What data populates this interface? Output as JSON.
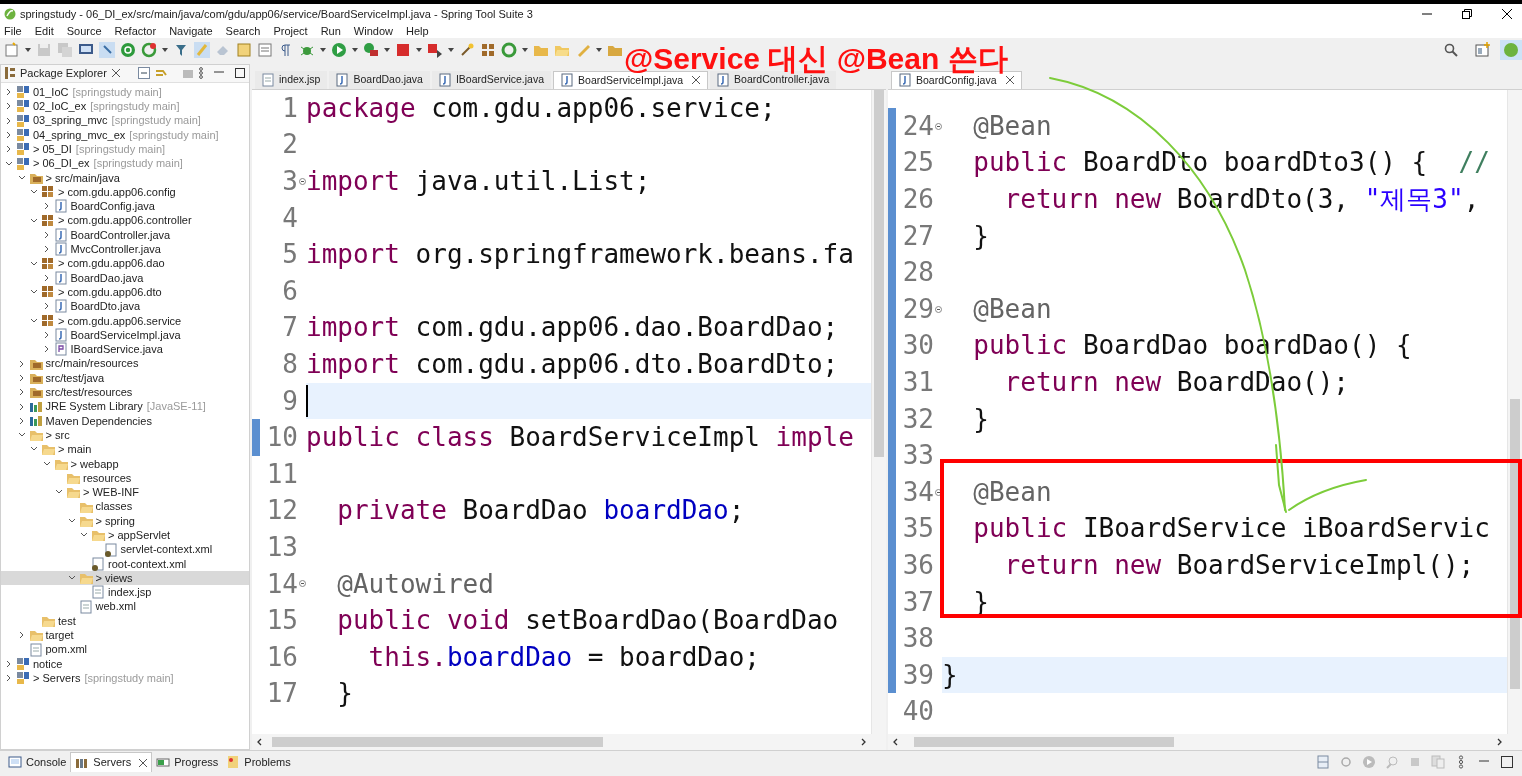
{
  "window": {
    "title": "springstudy - 06_DI_ex/src/main/java/com/gdu/app06/service/BoardServiceImpl.java - Spring Tool Suite 3"
  },
  "menu": [
    "File",
    "Edit",
    "Source",
    "Refactor",
    "Navigate",
    "Search",
    "Project",
    "Run",
    "Window",
    "Help"
  ],
  "package_explorer": {
    "title": "Package Explorer",
    "tree": [
      {
        "label": "01_IoC",
        "decoration": "[springstudy main]",
        "kind": "project",
        "expanded": false,
        "selected": false
      },
      {
        "label": "02_IoC_ex",
        "decoration": "[springstudy main]",
        "kind": "project",
        "expanded": false,
        "selected": false
      },
      {
        "label": "03_spring_mvc",
        "decoration": "[springstudy main]",
        "kind": "project",
        "expanded": false,
        "selected": false
      },
      {
        "label": "04_spring_mvc_ex",
        "decoration": "[springstudy main]",
        "kind": "project",
        "expanded": false,
        "selected": false
      },
      {
        "label": "> 05_DI",
        "decoration": "[springstudy main]",
        "kind": "project",
        "expanded": false,
        "selected": false
      },
      {
        "label": "> 06_DI_ex",
        "decoration": "[springstudy main]",
        "kind": "project",
        "expanded": true,
        "selected": false,
        "children": [
          {
            "label": "> src/main/java",
            "kind": "source-folder",
            "expanded": true,
            "selected": false,
            "children": [
              {
                "label": "> com.gdu.app06.config",
                "kind": "package",
                "expanded": true,
                "selected": false,
                "children": [
                  {
                    "label": "BoardConfig.java",
                    "kind": "java",
                    "expanded": false,
                    "selected": false
                  }
                ]
              },
              {
                "label": "> com.gdu.app06.controller",
                "kind": "package",
                "expanded": true,
                "selected": false,
                "children": [
                  {
                    "label": "BoardController.java",
                    "kind": "java",
                    "expanded": false,
                    "selected": false
                  },
                  {
                    "label": "MvcController.java",
                    "kind": "java",
                    "expanded": false,
                    "selected": false
                  }
                ]
              },
              {
                "label": "> com.gdu.app06.dao",
                "kind": "package",
                "expanded": true,
                "selected": false,
                "children": [
                  {
                    "label": "BoardDao.java",
                    "kind": "java",
                    "expanded": false,
                    "selected": false
                  }
                ]
              },
              {
                "label": "> com.gdu.app06.dto",
                "kind": "package",
                "expanded": true,
                "selected": false,
                "children": [
                  {
                    "label": "BoardDto.java",
                    "kind": "java",
                    "expanded": false,
                    "selected": false
                  }
                ]
              },
              {
                "label": "> com.gdu.app06.service",
                "kind": "package",
                "expanded": true,
                "selected": false,
                "children": [
                  {
                    "label": "BoardServiceImpl.java",
                    "kind": "java",
                    "expanded": false,
                    "selected": false
                  },
                  {
                    "label": "IBoardService.java",
                    "kind": "interface",
                    "expanded": false,
                    "selected": false
                  }
                ]
              }
            ]
          },
          {
            "label": "src/main/resources",
            "kind": "source-folder",
            "expanded": false,
            "selected": false
          },
          {
            "label": "src/test/java",
            "kind": "source-folder",
            "expanded": false,
            "selected": false
          },
          {
            "label": "src/test/resources",
            "kind": "source-folder",
            "expanded": false,
            "selected": false
          },
          {
            "label": "JRE System Library",
            "decoration": "[JavaSE-11]",
            "kind": "library",
            "expanded": false,
            "selected": false
          },
          {
            "label": "Maven Dependencies",
            "kind": "library",
            "expanded": false,
            "selected": false
          },
          {
            "label": "> src",
            "kind": "folder",
            "expanded": true,
            "selected": false,
            "children": [
              {
                "label": "> main",
                "kind": "folder",
                "expanded": true,
                "selected": false,
                "children": [
                  {
                    "label": "> webapp",
                    "kind": "folder",
                    "expanded": true,
                    "selected": false,
                    "children": [
                      {
                        "label": "resources",
                        "kind": "folder",
                        "selected": false
                      },
                      {
                        "label": "> WEB-INF",
                        "kind": "folder",
                        "expanded": true,
                        "selected": false,
                        "children": [
                          {
                            "label": "classes",
                            "kind": "folder",
                            "selected": false
                          },
                          {
                            "label": "> spring",
                            "kind": "folder",
                            "expanded": true,
                            "selected": false,
                            "children": [
                              {
                                "label": "> appServlet",
                                "kind": "folder",
                                "expanded": true,
                                "selected": false,
                                "children": [
                                  {
                                    "label": "servlet-context.xml",
                                    "kind": "xml",
                                    "selected": false
                                  }
                                ]
                              },
                              {
                                "label": "root-context.xml",
                                "kind": "xml",
                                "selected": false
                              }
                            ]
                          },
                          {
                            "label": "> views",
                            "kind": "folder",
                            "expanded": true,
                            "selected": true,
                            "children": [
                              {
                                "label": "index.jsp",
                                "kind": "file",
                                "selected": false
                              }
                            ]
                          },
                          {
                            "label": "web.xml",
                            "kind": "file",
                            "selected": false
                          }
                        ]
                      }
                    ]
                  }
                ]
              },
              {
                "label": "test",
                "kind": "folder",
                "selected": false
              }
            ]
          },
          {
            "label": "target",
            "kind": "folder",
            "expanded": false,
            "selected": false
          },
          {
            "label": "pom.xml",
            "kind": "file",
            "selected": false
          }
        ]
      },
      {
        "label": "notice",
        "kind": "project",
        "expanded": false,
        "selected": false
      },
      {
        "label": "> Servers",
        "decoration": "[springstudy main]",
        "kind": "project",
        "expanded": false,
        "selected": false
      }
    ]
  },
  "editors": [
    {
      "tabs": [
        {
          "label": "index.jsp",
          "kind": "jsp",
          "selected": false
        },
        {
          "label": "BoardDao.java",
          "kind": "java",
          "selected": false
        },
        {
          "label": "IBoardService.java",
          "kind": "java",
          "selected": false
        },
        {
          "label": "BoardServiceImpl.java",
          "kind": "java",
          "selected": true
        },
        {
          "label": "BoardController.java",
          "kind": "java",
          "selected": false
        }
      ],
      "lines": [
        {
          "number": "1",
          "tokens": [
            {
              "kind": "keyword",
              "text": "package"
            },
            {
              "kind": "plain",
              "text": " com.gdu.app06.service;"
            }
          ]
        },
        {
          "number": "2"
        },
        {
          "number": "3",
          "foldable": true,
          "tokens": [
            {
              "kind": "keyword",
              "text": "import"
            },
            {
              "kind": "plain",
              "text": " java.util.List;"
            }
          ]
        },
        {
          "number": "4"
        },
        {
          "number": "5",
          "tokens": [
            {
              "kind": "keyword",
              "text": "import"
            },
            {
              "kind": "plain",
              "text": " org.springframework.beans.fa"
            }
          ]
        },
        {
          "number": "6"
        },
        {
          "number": "7",
          "tokens": [
            {
              "kind": "keyword",
              "text": "import"
            },
            {
              "kind": "plain",
              "text": " com.gdu.app06.dao.BoardDao;"
            }
          ]
        },
        {
          "number": "8",
          "tokens": [
            {
              "kind": "keyword",
              "text": "import"
            },
            {
              "kind": "plain",
              "text": " com.gdu.app06.dto.BoardDto;"
            }
          ]
        },
        {
          "number": "9",
          "current": true
        },
        {
          "number": "10",
          "in_range": true,
          "tokens": [
            {
              "kind": "keyword",
              "text": "public class"
            },
            {
              "kind": "plain",
              "text": " BoardServiceImpl "
            },
            {
              "kind": "keyword",
              "text": "imple"
            }
          ]
        },
        {
          "number": "11"
        },
        {
          "number": "12",
          "tokens": [
            {
              "kind": "keyword",
              "text": "  private"
            },
            {
              "kind": "plain",
              "text": " BoardDao "
            },
            {
              "kind": "field",
              "text": "boardDao"
            },
            {
              "kind": "plain",
              "text": ";"
            }
          ]
        },
        {
          "number": "13"
        },
        {
          "number": "14",
          "foldable": true,
          "tokens": [
            {
              "kind": "annotation",
              "text": "  @Autowired"
            }
          ]
        },
        {
          "number": "15",
          "tokens": [
            {
              "kind": "keyword",
              "text": "  public void"
            },
            {
              "kind": "plain",
              "text": " setBoardDao(BoardDao"
            }
          ]
        },
        {
          "number": "16",
          "tokens": [
            {
              "kind": "keyword",
              "text": "    this."
            },
            {
              "kind": "field",
              "text": "boardDao"
            },
            {
              "kind": "plain",
              "text": " = boardDao;"
            }
          ]
        },
        {
          "number": "17",
          "tokens": [
            {
              "kind": "plain",
              "text": "  }"
            }
          ]
        }
      ]
    },
    {
      "tabs": [
        {
          "label": "BoardConfig.java",
          "kind": "java",
          "selected": true
        }
      ],
      "lines": [
        {
          "number": "24",
          "foldable": true,
          "in_range": true,
          "tokens": [
            {
              "kind": "annotation",
              "text": "  @Bean"
            }
          ]
        },
        {
          "number": "25",
          "in_range": true,
          "tokens": [
            {
              "kind": "keyword",
              "text": "  public"
            },
            {
              "kind": "plain",
              "text": " BoardDto boardDto3() {  "
            },
            {
              "kind": "comment",
              "text": "//"
            }
          ]
        },
        {
          "number": "26",
          "in_range": true,
          "tokens": [
            {
              "kind": "keyword",
              "text": "    return new"
            },
            {
              "kind": "plain",
              "text": " BoardDto(3, "
            },
            {
              "kind": "string",
              "text": "\"제목3\""
            },
            {
              "kind": "plain",
              "text": ","
            }
          ]
        },
        {
          "number": "27",
          "in_range": true,
          "tokens": [
            {
              "kind": "plain",
              "text": "  }"
            }
          ]
        },
        {
          "number": "28",
          "in_range": true
        },
        {
          "number": "29",
          "foldable": true,
          "in_range": true,
          "tokens": [
            {
              "kind": "annotation",
              "text": "  @Bean"
            }
          ]
        },
        {
          "number": "30",
          "in_range": true,
          "tokens": [
            {
              "kind": "keyword",
              "text": "  public"
            },
            {
              "kind": "plain",
              "text": " BoardDao boardDao() {"
            }
          ]
        },
        {
          "number": "31",
          "in_range": true,
          "tokens": [
            {
              "kind": "keyword",
              "text": "    return new"
            },
            {
              "kind": "plain",
              "text": " BoardDao();"
            }
          ]
        },
        {
          "number": "32",
          "in_range": true,
          "tokens": [
            {
              "kind": "plain",
              "text": "  }"
            }
          ]
        },
        {
          "number": "33",
          "in_range": true
        },
        {
          "number": "34",
          "foldable": true,
          "in_range": true,
          "tokens": [
            {
              "kind": "annotation",
              "text": "  @Bean"
            }
          ]
        },
        {
          "number": "35",
          "in_range": true,
          "tokens": [
            {
              "kind": "keyword",
              "text": "  public"
            },
            {
              "kind": "plain",
              "text": " IBoardService iBoardServic"
            }
          ]
        },
        {
          "number": "36",
          "in_range": true,
          "tokens": [
            {
              "kind": "keyword",
              "text": "    return new"
            },
            {
              "kind": "plain",
              "text": " BoardServiceImpl();"
            }
          ]
        },
        {
          "number": "37",
          "in_range": true,
          "tokens": [
            {
              "kind": "plain",
              "text": "  }"
            }
          ]
        },
        {
          "number": "38",
          "in_range": true
        },
        {
          "number": "39",
          "current": true,
          "in_range": true,
          "tokens": [
            {
              "kind": "plain",
              "text": "}"
            }
          ]
        },
        {
          "number": "40"
        }
      ]
    }
  ],
  "bottom_panel": {
    "tabs": [
      {
        "label": "Console",
        "kind": "console",
        "selected": false
      },
      {
        "label": "Servers",
        "kind": "servers",
        "selected": true
      },
      {
        "label": "Progress",
        "kind": "progress",
        "selected": false
      },
      {
        "label": "Problems",
        "kind": "problems",
        "selected": false
      }
    ]
  },
  "overlay": {
    "caption": "@Service 대신 @Bean 쓴다"
  }
}
